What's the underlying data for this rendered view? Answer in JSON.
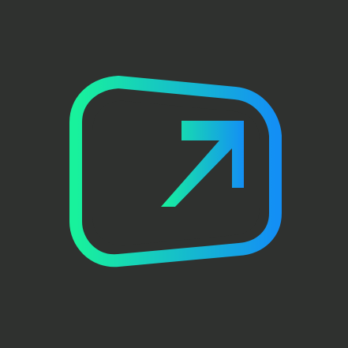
{
  "app": {
    "icon_name": "screen-arrow-up-right-icon",
    "background_color": "#2f312f",
    "gradient": {
      "start": "#18f29c",
      "end": "#138ff5"
    }
  }
}
